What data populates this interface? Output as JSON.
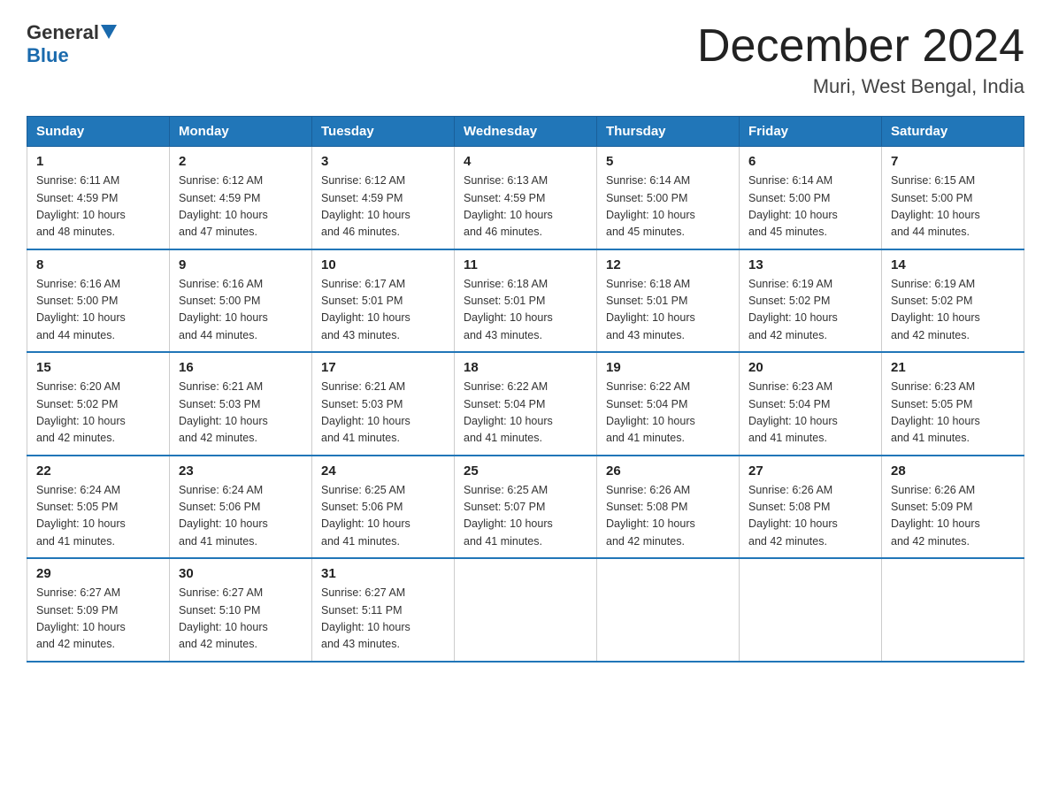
{
  "header": {
    "logo_general": "General",
    "logo_blue": "Blue",
    "month_title": "December 2024",
    "location": "Muri, West Bengal, India"
  },
  "days_of_week": [
    "Sunday",
    "Monday",
    "Tuesday",
    "Wednesday",
    "Thursday",
    "Friday",
    "Saturday"
  ],
  "weeks": [
    [
      {
        "day": "1",
        "sunrise": "6:11 AM",
        "sunset": "4:59 PM",
        "daylight": "10 hours and 48 minutes."
      },
      {
        "day": "2",
        "sunrise": "6:12 AM",
        "sunset": "4:59 PM",
        "daylight": "10 hours and 47 minutes."
      },
      {
        "day": "3",
        "sunrise": "6:12 AM",
        "sunset": "4:59 PM",
        "daylight": "10 hours and 46 minutes."
      },
      {
        "day": "4",
        "sunrise": "6:13 AM",
        "sunset": "4:59 PM",
        "daylight": "10 hours and 46 minutes."
      },
      {
        "day": "5",
        "sunrise": "6:14 AM",
        "sunset": "5:00 PM",
        "daylight": "10 hours and 45 minutes."
      },
      {
        "day": "6",
        "sunrise": "6:14 AM",
        "sunset": "5:00 PM",
        "daylight": "10 hours and 45 minutes."
      },
      {
        "day": "7",
        "sunrise": "6:15 AM",
        "sunset": "5:00 PM",
        "daylight": "10 hours and 44 minutes."
      }
    ],
    [
      {
        "day": "8",
        "sunrise": "6:16 AM",
        "sunset": "5:00 PM",
        "daylight": "10 hours and 44 minutes."
      },
      {
        "day": "9",
        "sunrise": "6:16 AM",
        "sunset": "5:00 PM",
        "daylight": "10 hours and 44 minutes."
      },
      {
        "day": "10",
        "sunrise": "6:17 AM",
        "sunset": "5:01 PM",
        "daylight": "10 hours and 43 minutes."
      },
      {
        "day": "11",
        "sunrise": "6:18 AM",
        "sunset": "5:01 PM",
        "daylight": "10 hours and 43 minutes."
      },
      {
        "day": "12",
        "sunrise": "6:18 AM",
        "sunset": "5:01 PM",
        "daylight": "10 hours and 43 minutes."
      },
      {
        "day": "13",
        "sunrise": "6:19 AM",
        "sunset": "5:02 PM",
        "daylight": "10 hours and 42 minutes."
      },
      {
        "day": "14",
        "sunrise": "6:19 AM",
        "sunset": "5:02 PM",
        "daylight": "10 hours and 42 minutes."
      }
    ],
    [
      {
        "day": "15",
        "sunrise": "6:20 AM",
        "sunset": "5:02 PM",
        "daylight": "10 hours and 42 minutes."
      },
      {
        "day": "16",
        "sunrise": "6:21 AM",
        "sunset": "5:03 PM",
        "daylight": "10 hours and 42 minutes."
      },
      {
        "day": "17",
        "sunrise": "6:21 AM",
        "sunset": "5:03 PM",
        "daylight": "10 hours and 41 minutes."
      },
      {
        "day": "18",
        "sunrise": "6:22 AM",
        "sunset": "5:04 PM",
        "daylight": "10 hours and 41 minutes."
      },
      {
        "day": "19",
        "sunrise": "6:22 AM",
        "sunset": "5:04 PM",
        "daylight": "10 hours and 41 minutes."
      },
      {
        "day": "20",
        "sunrise": "6:23 AM",
        "sunset": "5:04 PM",
        "daylight": "10 hours and 41 minutes."
      },
      {
        "day": "21",
        "sunrise": "6:23 AM",
        "sunset": "5:05 PM",
        "daylight": "10 hours and 41 minutes."
      }
    ],
    [
      {
        "day": "22",
        "sunrise": "6:24 AM",
        "sunset": "5:05 PM",
        "daylight": "10 hours and 41 minutes."
      },
      {
        "day": "23",
        "sunrise": "6:24 AM",
        "sunset": "5:06 PM",
        "daylight": "10 hours and 41 minutes."
      },
      {
        "day": "24",
        "sunrise": "6:25 AM",
        "sunset": "5:06 PM",
        "daylight": "10 hours and 41 minutes."
      },
      {
        "day": "25",
        "sunrise": "6:25 AM",
        "sunset": "5:07 PM",
        "daylight": "10 hours and 41 minutes."
      },
      {
        "day": "26",
        "sunrise": "6:26 AM",
        "sunset": "5:08 PM",
        "daylight": "10 hours and 42 minutes."
      },
      {
        "day": "27",
        "sunrise": "6:26 AM",
        "sunset": "5:08 PM",
        "daylight": "10 hours and 42 minutes."
      },
      {
        "day": "28",
        "sunrise": "6:26 AM",
        "sunset": "5:09 PM",
        "daylight": "10 hours and 42 minutes."
      }
    ],
    [
      {
        "day": "29",
        "sunrise": "6:27 AM",
        "sunset": "5:09 PM",
        "daylight": "10 hours and 42 minutes."
      },
      {
        "day": "30",
        "sunrise": "6:27 AM",
        "sunset": "5:10 PM",
        "daylight": "10 hours and 42 minutes."
      },
      {
        "day": "31",
        "sunrise": "6:27 AM",
        "sunset": "5:11 PM",
        "daylight": "10 hours and 43 minutes."
      },
      null,
      null,
      null,
      null
    ]
  ],
  "labels": {
    "sunrise": "Sunrise:",
    "sunset": "Sunset:",
    "daylight": "Daylight:"
  }
}
